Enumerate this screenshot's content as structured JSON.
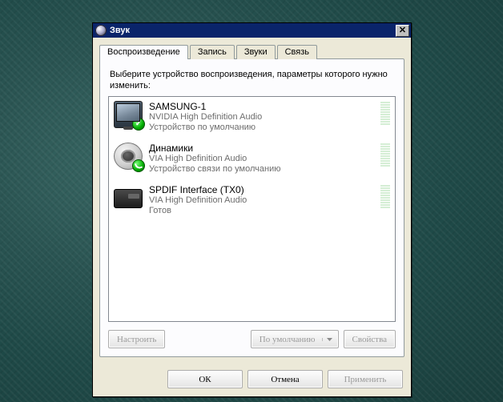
{
  "window": {
    "title": "Звук"
  },
  "tabs": [
    {
      "label": "Воспроизведение",
      "active": true
    },
    {
      "label": "Запись",
      "active": false
    },
    {
      "label": "Звуки",
      "active": false
    },
    {
      "label": "Связь",
      "active": false
    }
  ],
  "instructions": "Выберите устройство воспроизведения, параметры которого нужно изменить:",
  "devices": [
    {
      "name": "SAMSUNG-1",
      "driver": "NVIDIA High Definition Audio",
      "status": "Устройство по умолчанию",
      "icon": "monitor",
      "badge": "check"
    },
    {
      "name": "Динамики",
      "driver": "VIA High Definition Audio",
      "status": "Устройство связи по умолчанию",
      "icon": "speaker",
      "badge": "phone"
    },
    {
      "name": "SPDIF Interface (TX0)",
      "driver": "VIA High Definition Audio",
      "status": "Готов",
      "icon": "spdif",
      "badge": ""
    }
  ],
  "panel_buttons": {
    "configure": "Настроить",
    "default": "По умолчанию",
    "properties": "Свойства"
  },
  "dialog_buttons": {
    "ok": "ОК",
    "cancel": "Отмена",
    "apply": "Применить"
  }
}
